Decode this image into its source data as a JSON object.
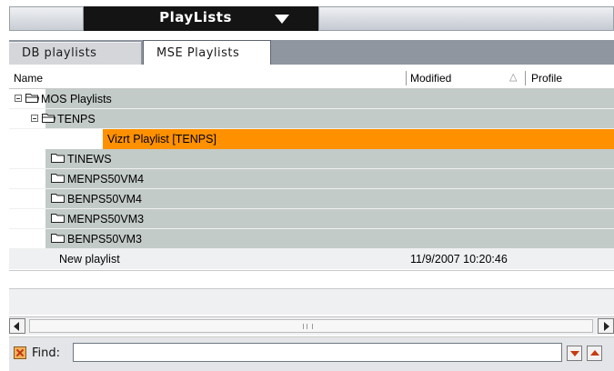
{
  "panel": {
    "title": "PlayLists"
  },
  "tabs": [
    {
      "label": "DB playlists",
      "active": false
    },
    {
      "label": "MSE Playlists",
      "active": true
    }
  ],
  "columns": {
    "name": "Name",
    "modified": "Modified",
    "profile": "Profile"
  },
  "rows": [
    {
      "label": "MOS Playlists",
      "modified": "",
      "icon": "folder-open-icon",
      "expander": "collapse"
    },
    {
      "label": "TENPS",
      "modified": "",
      "icon": "folder-open-icon",
      "expander": "collapse"
    },
    {
      "label": "Vizrt Playlist [TENPS]",
      "modified": "",
      "icon": "",
      "selected": true
    },
    {
      "label": "TINEWS",
      "modified": "",
      "icon": "folder-icon"
    },
    {
      "label": "MENPS50VM4",
      "modified": "",
      "icon": "folder-icon"
    },
    {
      "label": "BENPS50VM4",
      "modified": "",
      "icon": "folder-icon"
    },
    {
      "label": "MENPS50VM3",
      "modified": "",
      "icon": "folder-icon"
    },
    {
      "label": "BENPS50VM3",
      "modified": "",
      "icon": "folder-icon"
    },
    {
      "label": "New playlist",
      "modified": "11/9/2007 10:20:46",
      "icon": ""
    }
  ],
  "find": {
    "label": "Find:",
    "value": "",
    "placeholder": ""
  },
  "colors": {
    "selection": "#ff9100",
    "row_bg": "#c3cbc8",
    "title_bg": "#141414"
  }
}
